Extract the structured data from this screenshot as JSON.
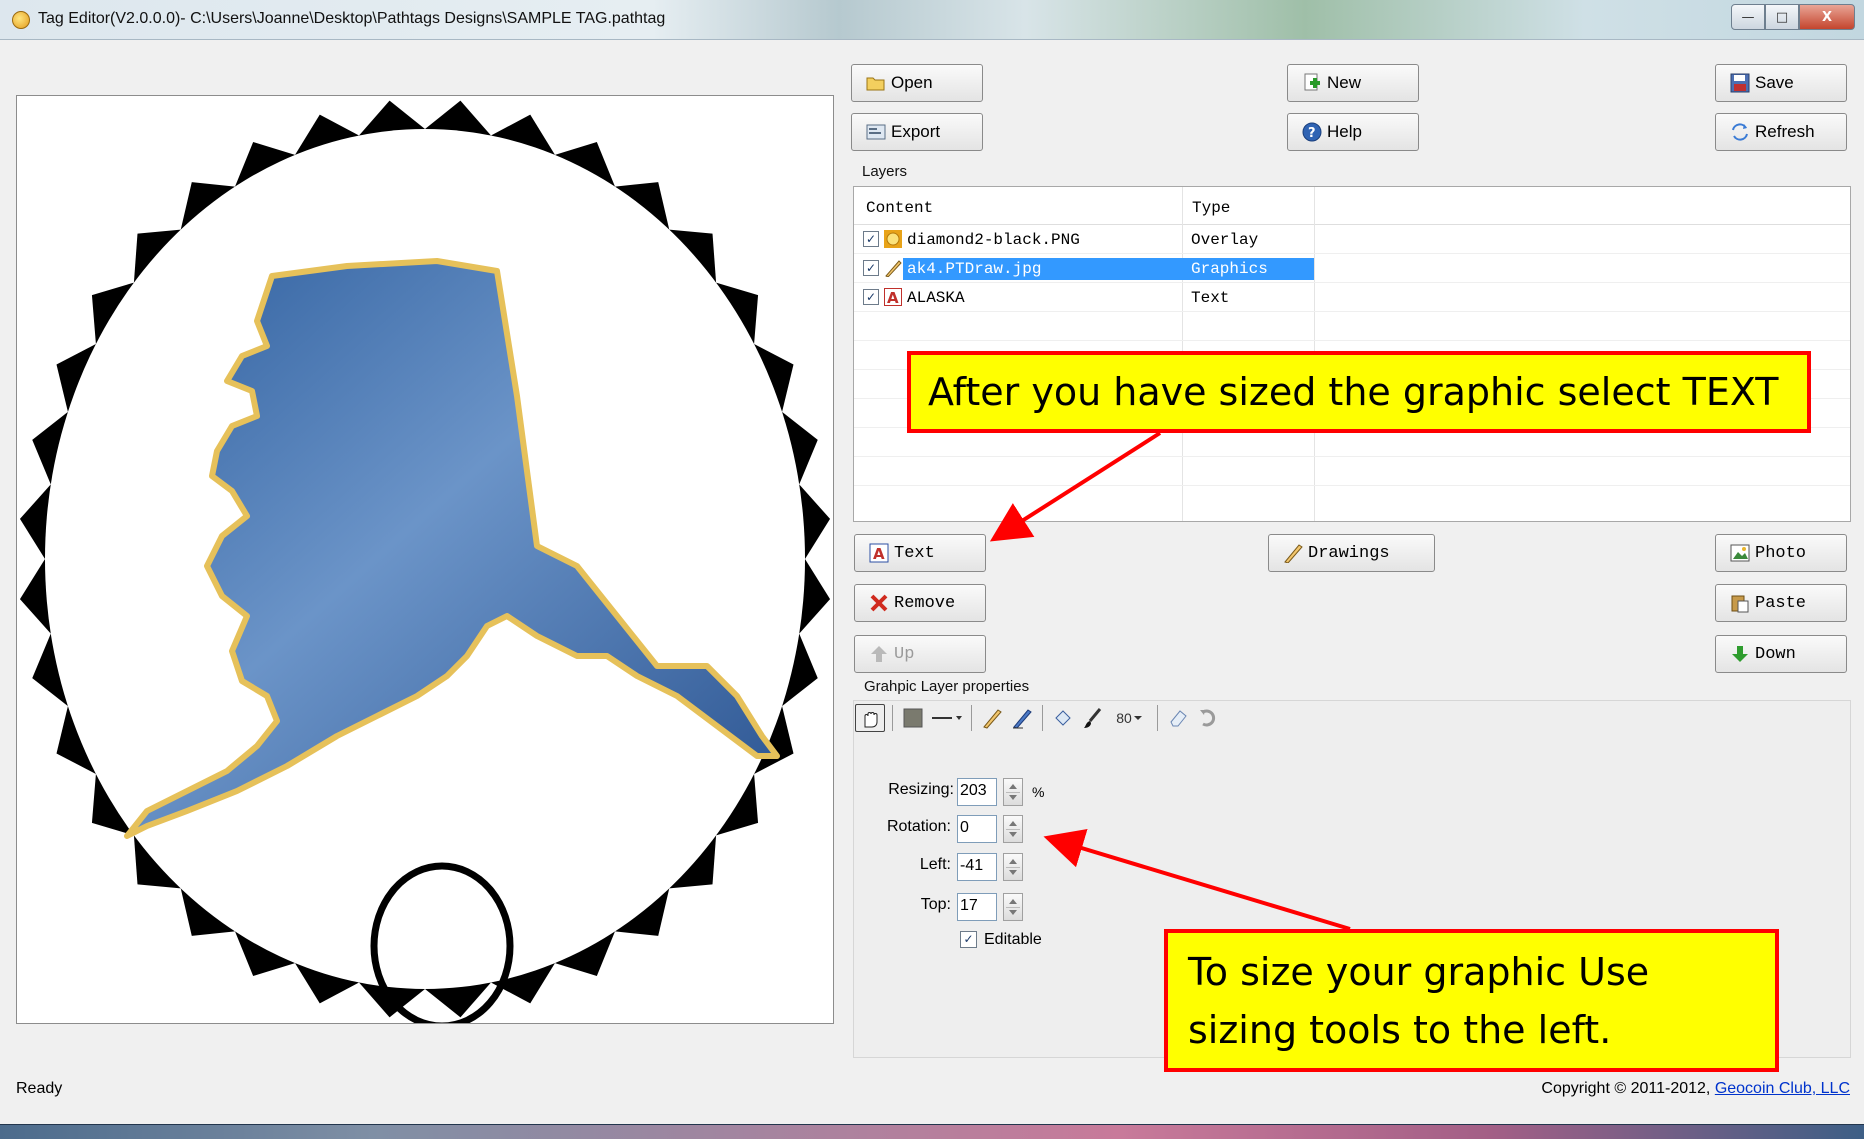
{
  "window": {
    "title": "Tag Editor(V2.0.0.0)- C:\\Users\\Joanne\\Desktop\\Pathtags Designs\\SAMPLE TAG.pathtag",
    "min_glyph": "—",
    "max_glyph": "□",
    "close_glyph": "X"
  },
  "toolbar_buttons": {
    "open": "Open",
    "new": "New",
    "save": "Save",
    "export": "Export",
    "help": "Help",
    "refresh": "Refresh"
  },
  "layers": {
    "label": "Layers",
    "columns": [
      "Content",
      "Type"
    ],
    "rows": [
      {
        "checked": "✓",
        "icon": "coin-icon",
        "content": "diamond2-black.PNG",
        "type": "Overlay"
      },
      {
        "checked": "✓",
        "icon": "pencil-icon",
        "content": "ak4.PTDraw.jpg",
        "type": "Graphics"
      },
      {
        "checked": "✓",
        "icon": "text-layer-icon",
        "content": "ALASKA",
        "type": "Text"
      }
    ]
  },
  "layer_buttons": {
    "text": "Text",
    "drawings": "Drawings",
    "photo": "Photo",
    "remove": "Remove",
    "paste": "Paste",
    "up": "Up",
    "down": "Down"
  },
  "properties": {
    "label": "Grahpic Layer properties",
    "opacity": "80",
    "resizing_label": "Resizing:",
    "resizing_value": "203",
    "resizing_unit": "%",
    "rotation_label": "Rotation:",
    "rotation_value": "0",
    "left_label": "Left:",
    "left_value": "-41",
    "top_label": "Top:",
    "top_value": "17",
    "editable_label": "Editable",
    "editable_checked": "✓"
  },
  "callouts": {
    "select_text": "After you have sized the graphic select TEXT",
    "sizing_line1": "To size your graphic Use",
    "sizing_line2": "sizing tools to the left."
  },
  "status": {
    "text": "Ready",
    "copyright": "Copyright © 2011-2012,",
    "company": "Geocoin Club, LLC"
  },
  "colors": {
    "selection": "#3399ff",
    "callout_fill": "#ffff00",
    "callout_border": "#ff0000",
    "alaska_fill": "#4a78b4"
  }
}
